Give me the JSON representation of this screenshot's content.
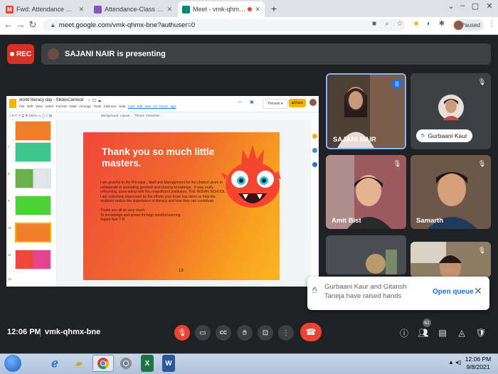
{
  "browser": {
    "tabs": [
      {
        "label": "Fwd: Attendance Link for III - IV",
        "favicon": "gmail-icon",
        "favicon_text": "M",
        "color": "#ea4335"
      },
      {
        "label": "Attendance-Class III, IV",
        "favicon": "sheets-icon",
        "favicon_text": "",
        "color": "#7e57c2"
      },
      {
        "label": "Meet - vmk-qhmx-bne",
        "favicon": "meet-icon",
        "favicon_text": "",
        "color": "#00897b"
      }
    ],
    "url": "meet.google.com/vmk-qhmx-bne?authuser=0",
    "profile_status": "Paused"
  },
  "meet": {
    "rec_label": "REC",
    "presenting_banner": "SAJANI NAIR is presenting",
    "meeting_time": "12:06 PM",
    "meeting_code": "vmk-qhmx-bne",
    "participant_count": "62",
    "participants": [
      {
        "name": "SAJANI NAIR"
      },
      {
        "name": "Gurbaani Kaur"
      },
      {
        "name": "Amit Bist"
      },
      {
        "name": "Samarth"
      }
    ],
    "raised_hands_message": "Gurbaani Kaur and Gitansh Taneja have raised hands",
    "open_queue_label": "Open queue"
  },
  "slides": {
    "doc_title": "world literacy day - SlidesCarnival",
    "menu_items": [
      "File",
      "Edit",
      "View",
      "Insert",
      "Format",
      "Slide",
      "Arrange",
      "Tools",
      "Add-ons",
      "Help"
    ],
    "last_edit": "Last edit was 13 hours ago",
    "present_label": "Present",
    "share_label": "Share",
    "format_tools": [
      "Background",
      "Layout",
      "Theme",
      "Transition"
    ],
    "thumb_numbers": [
      "7",
      "8",
      "9",
      "10",
      "11",
      "12"
    ],
    "slide_title": "Thank you so much little masters.",
    "slide_paragraph_1": "I am grateful to the Principal , Staff and Management for the chance given to collaborate in spreading goodwill and sharing knowledge . It was really refreshing, associating with this magnificent institution, THE INDIAN SCHOOL.",
    "slide_paragraph_2": "I am extremely impressed by the efforts your team has taken to help the students realize the importance of literacy and how they can contribute.",
    "slide_paragraph_3": "Thank you all so very much.",
    "slide_paragraph_4": "To knowledge and power through mindful learning.",
    "slide_paragraph_5": "Sajani Nair T R",
    "slide_number": "13"
  },
  "taskbar": {
    "clock_time": "12:06 PM",
    "clock_date": "9/8/2021"
  },
  "colors": {
    "meet_bg": "#202124",
    "rec_red": "#d93025",
    "leave_red": "#ea4335",
    "accent_blue": "#1a73e8",
    "slides_yellow": "#f4b400"
  }
}
